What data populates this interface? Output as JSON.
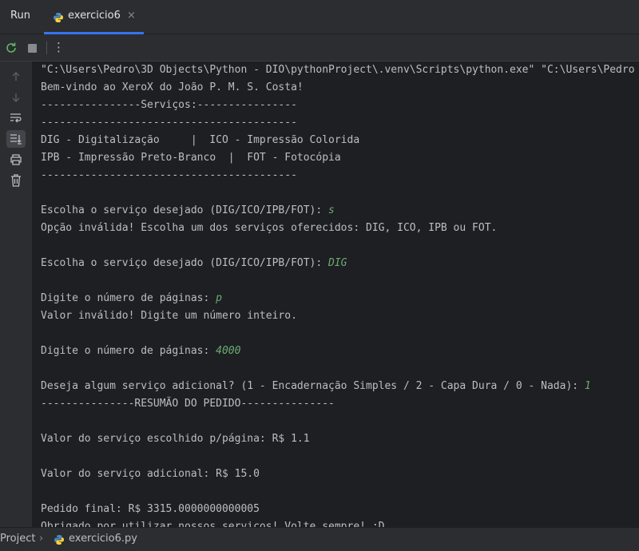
{
  "header": {
    "run_label": "Run",
    "tab_label": "exercicio6",
    "close_glyph": "×"
  },
  "toolbar": {
    "rerun_icon": "rerun-icon",
    "stop_icon": "stop-icon",
    "more_glyph": "⋮"
  },
  "sidebar": {
    "icons": [
      "arrow-up-icon",
      "arrow-down-icon",
      "soft-wrap-icon",
      "scroll-to-end-icon",
      "print-icon",
      "trash-icon"
    ]
  },
  "console": {
    "lines": [
      {
        "text": "\"C:\\Users\\Pedro\\3D Objects\\Python - DIO\\pythonProject\\.venv\\Scripts\\python.exe\" \"C:\\Users\\Pedro",
        "input": ""
      },
      {
        "text": "Bem-vindo ao XeroX do João P. M. S. Costa!",
        "input": ""
      },
      {
        "text": "----------------Serviços:----------------",
        "input": ""
      },
      {
        "text": "-----------------------------------------",
        "input": ""
      },
      {
        "text": "DIG - Digitalização     |  ICO - Impressão Colorida",
        "input": ""
      },
      {
        "text": "IPB - Impressão Preto-Branco  |  FOT - Fotocópia",
        "input": ""
      },
      {
        "text": "-----------------------------------------",
        "input": ""
      },
      {
        "text": "",
        "input": ""
      },
      {
        "text": "Escolha o serviço desejado (DIG/ICO/IPB/FOT): ",
        "input": "s"
      },
      {
        "text": "Opção inválida! Escolha um dos serviços oferecidos: DIG, ICO, IPB ou FOT.",
        "input": ""
      },
      {
        "text": "",
        "input": ""
      },
      {
        "text": "Escolha o serviço desejado (DIG/ICO/IPB/FOT): ",
        "input": "DIG"
      },
      {
        "text": "",
        "input": ""
      },
      {
        "text": "Digite o número de páginas: ",
        "input": "p"
      },
      {
        "text": "Valor inválido! Digite um número inteiro.",
        "input": ""
      },
      {
        "text": "",
        "input": ""
      },
      {
        "text": "Digite o número de páginas: ",
        "input": "4000"
      },
      {
        "text": "",
        "input": ""
      },
      {
        "text": "Deseja algum serviço adicional? (1 - Encadernação Simples / 2 - Capa Dura / 0 - Nada): ",
        "input": "1"
      },
      {
        "text": "---------------RESUMÃO DO PEDIDO---------------",
        "input": ""
      },
      {
        "text": "",
        "input": ""
      },
      {
        "text": "Valor do serviço escolhido p/página: R$ 1.1",
        "input": ""
      },
      {
        "text": "",
        "input": ""
      },
      {
        "text": "Valor do serviço adicional: R$ 15.0",
        "input": ""
      },
      {
        "text": "",
        "input": ""
      },
      {
        "text": "Pedido final: R$ 3315.0000000000005",
        "input": ""
      },
      {
        "text": "Obrigado por utilizar nossos serviços! Volte sempre! :D",
        "input": ""
      }
    ]
  },
  "statusbar": {
    "crumb_project": "Project",
    "chevron": "›",
    "crumb_file": "exercicio6.py"
  }
}
